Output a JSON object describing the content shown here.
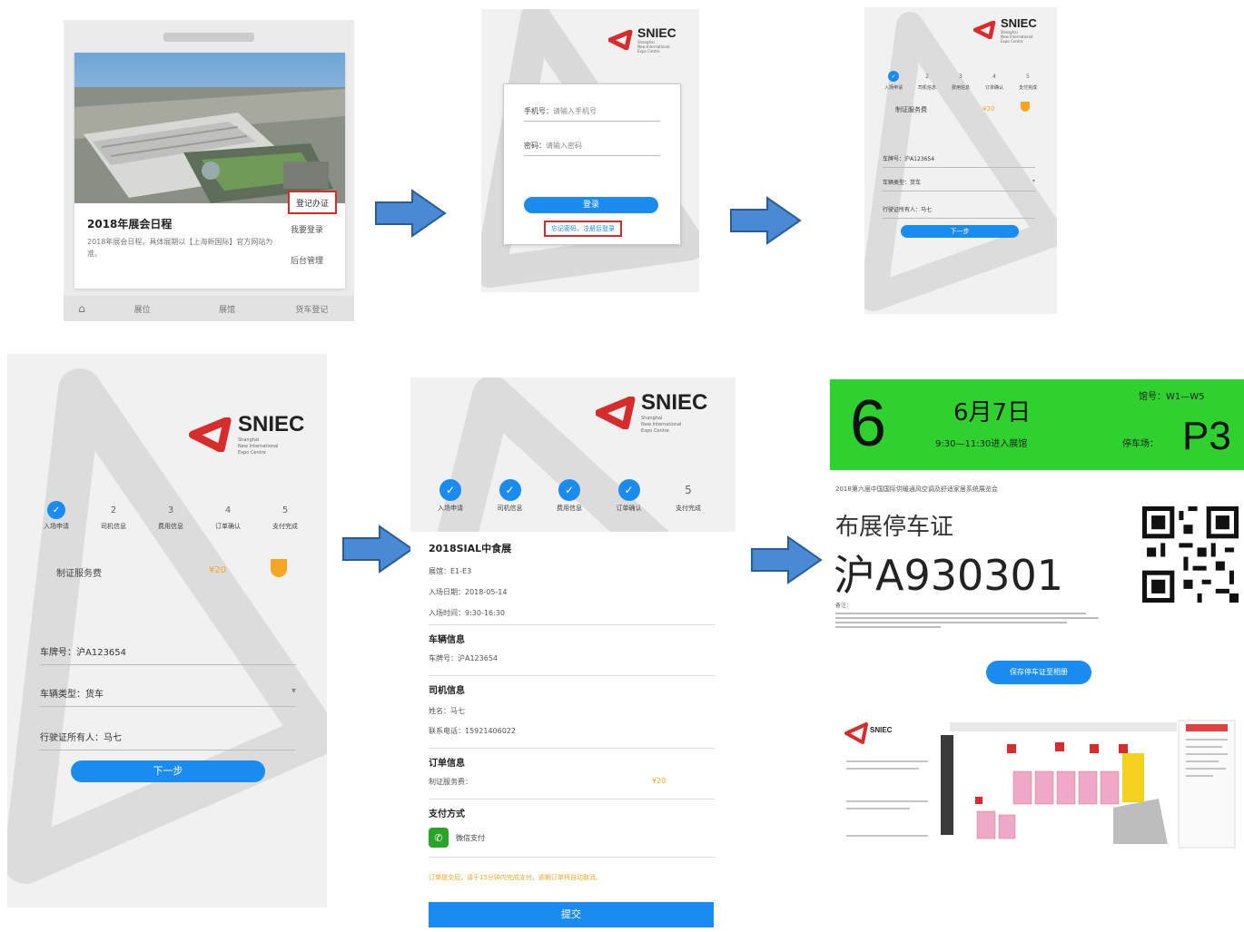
{
  "colors": {
    "accent": "#1a8cf0",
    "arrow": "#4a8ad4",
    "arrow_border": "#2a5d98",
    "green": "#2ed12e",
    "red_highlight": "#d82c2c",
    "orange": "#f5a623"
  },
  "brand": {
    "name": "SNIEC",
    "sub": [
      "Shanghai",
      "New International",
      "Expo Centre"
    ]
  },
  "screen1": {
    "top_bar": "",
    "card_title": "2018年展会日程",
    "card_text": "2018年展会日程，具体展期以【上海新国际】官方网站为准。",
    "side_actions": [
      "登记办证",
      "我要登录",
      "后台管理"
    ],
    "bottom_nav": [
      "展位",
      "展馆",
      "货车登记"
    ],
    "home_icon": "home-icon"
  },
  "screen2": {
    "phone_label": "手机号：",
    "phone_placeholder": "请输入手机号",
    "password_label": "密码：",
    "password_placeholder": "请输入密码",
    "login_button": "登录",
    "forgot_link": "忘记密码，注册后登录"
  },
  "screen3": {
    "steps": [
      {
        "num": "1",
        "label": "入场申请",
        "done": true
      },
      {
        "num": "2",
        "label": "司机信息",
        "done": false
      },
      {
        "num": "3",
        "label": "费用信息",
        "done": false
      },
      {
        "num": "4",
        "label": "订单确认",
        "done": false
      },
      {
        "num": "5",
        "label": "支付完成",
        "done": false
      }
    ],
    "fee_label": "制证服务费",
    "fee_value": "¥20",
    "plate_label": "车牌号：",
    "plate_value": "沪A123654",
    "type_label": "车辆类型：",
    "type_value": "货车",
    "owner_label": "行驶证所有人：",
    "owner_value": "马七",
    "next_button": "下一步"
  },
  "screen4": {
    "steps": [
      {
        "num": "1",
        "label": "入场申请",
        "done": true
      },
      {
        "num": "2",
        "label": "司机信息",
        "done": false
      },
      {
        "num": "3",
        "label": "费用信息",
        "done": false
      },
      {
        "num": "4",
        "label": "订单确认",
        "done": false
      },
      {
        "num": "5",
        "label": "支付完成",
        "done": false
      }
    ],
    "fee_label": "制证服务费",
    "fee_value": "¥20",
    "plate_label": "车牌号：",
    "plate_value": "沪A123654",
    "type_label": "车辆类型：",
    "type_value": "货车",
    "owner_label": "行驶证所有人：",
    "owner_value": "马七",
    "next_button": "下一步"
  },
  "screen5": {
    "steps": [
      {
        "num": "",
        "label": "入场申请",
        "done": true
      },
      {
        "num": "",
        "label": "司机信息",
        "done": true
      },
      {
        "num": "",
        "label": "费用信息",
        "done": true
      },
      {
        "num": "",
        "label": "订单确认",
        "done": true
      },
      {
        "num": "5",
        "label": "支付完成",
        "done": false
      }
    ],
    "event_title": "2018SIAL中食展",
    "hall": "展馆：E1-E3",
    "entry_date": "入场日期：2018-05-14",
    "entry_time": "入场时间：9:30-16:30",
    "vehicle_heading": "车辆信息",
    "vehicle_plate": "车牌号：沪A123654",
    "driver_heading": "司机信息",
    "driver_name": "姓名：马七",
    "driver_phone": "联系电话：15921406022",
    "order_heading": "订单信息",
    "order_fee_label": "制证服务费：",
    "order_fee_value": "¥20",
    "payment_heading": "支付方式",
    "payment_method": "微信支付",
    "notice": "订单提交后，请于15分钟内完成支付，逾期订单将自动取消。",
    "submit_button": "提交"
  },
  "screen6": {
    "day_number": "6",
    "date": "6月7日",
    "time_range": "9:30—11:30进入展馆",
    "hall_label": "馆号：",
    "hall_value": "W1—W5",
    "parking_label": "停车场：",
    "parking_value": "P3",
    "event_line": "2018第六届中国国际供暖通风空调及舒适家居系统展览会",
    "permit_title": "布展停车证",
    "plate": "沪A930301",
    "notes_label": "备注：",
    "save_button": "保存停车证至相册",
    "map_caption": "SNIEC"
  }
}
